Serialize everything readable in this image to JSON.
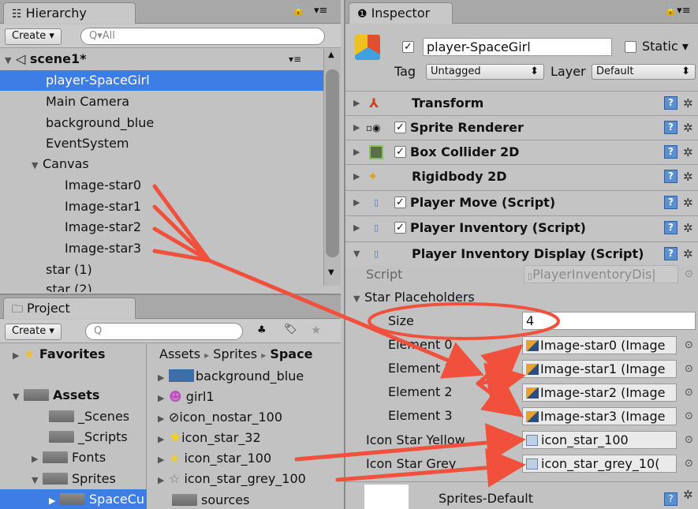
{
  "hierarchy": {
    "tab_label": "Hierarchy",
    "create_label": "Create",
    "search_placeholder": "Q▾All",
    "scene_name": "scene1*",
    "items": [
      "player-SpaceGirl",
      "Main Camera",
      "background_blue",
      "EventSystem",
      "Canvas",
      "Image-star0",
      "Image-star1",
      "Image-star2",
      "Image-star3",
      "star (1)",
      "star (2)"
    ]
  },
  "project": {
    "tab_label": "Project",
    "create_label": "Create",
    "search_placeholder": "Q",
    "favorites_label": "Favorites",
    "assets_label": "Assets",
    "tree": [
      "_Scenes",
      "_Scripts",
      "Fonts",
      "Sprites",
      "SpaceCu"
    ],
    "breadcrumb": [
      "Assets",
      "Sprites",
      "Space"
    ],
    "files": [
      "background_blue",
      "girl1",
      "icon_nostar_100",
      "icon_star_32",
      "icon_star_100",
      "icon_star_grey_100",
      "sources"
    ]
  },
  "inspector": {
    "tab_label": "Inspector",
    "object_name": "player-SpaceGirl",
    "static_label": "Static",
    "tag_label": "Tag",
    "tag_value": "Untagged",
    "layer_label": "Layer",
    "layer_value": "Default",
    "components": [
      "Transform",
      "Sprite Renderer",
      "Box Collider 2D",
      "Rigidbody 2D",
      "Player Move (Script)",
      "Player Inventory (Script)",
      "Player Inventory Display (Script)"
    ],
    "script_label": "Script",
    "script_value": "PlayerInventoryDis|",
    "star_placeholders_label": "Star Placeholders",
    "size_label": "Size",
    "size_value": "4",
    "elements": [
      {
        "label": "Element 0",
        "value": "Image-star0 (Image"
      },
      {
        "label": "Element 1",
        "value": "Image-star1 (Image"
      },
      {
        "label": "Element 2",
        "value": "Image-star2 (Image"
      },
      {
        "label": "Element 3",
        "value": "Image-star3 (Image"
      }
    ],
    "icon_yellow_label": "Icon Star Yellow",
    "icon_yellow_value": "icon_star_100",
    "icon_grey_label": "Icon Star Grey",
    "icon_grey_value": "icon_star_grey_10(",
    "material_label": "Sprites-Default"
  },
  "colors": {
    "selection": "#3e7de3",
    "annotation": "#f0503c"
  }
}
